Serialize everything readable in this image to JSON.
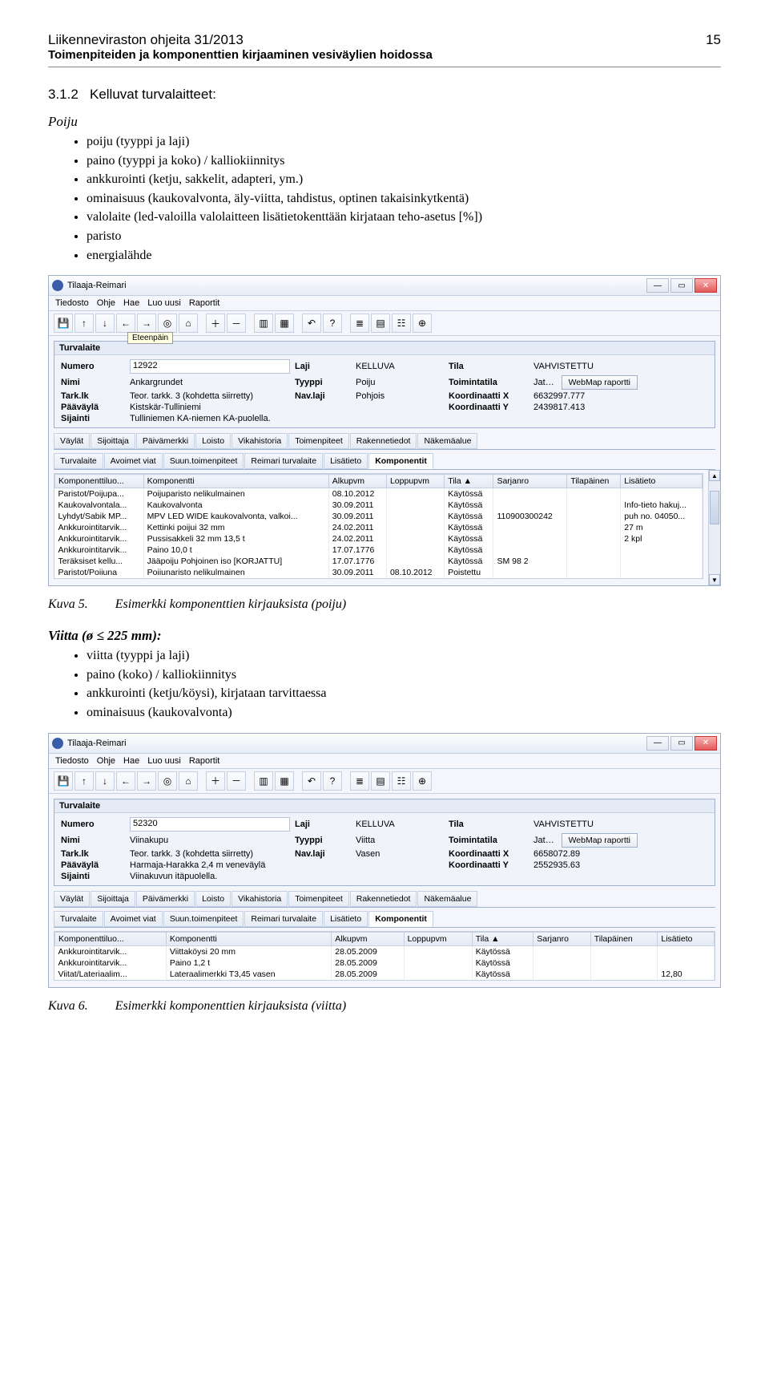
{
  "header": {
    "title": "Liikenneviraston ohjeita 31/2013",
    "page": "15",
    "subtitle": "Toimenpiteiden ja komponenttien kirjaaminen vesiväylien hoidossa"
  },
  "section": {
    "number": "3.1.2",
    "title": "Kelluvat turvalaitteet:"
  },
  "poiju_heading": "Poiju",
  "poiju_items": [
    "poiju (tyyppi ja laji)",
    "paino (tyyppi ja koko) / kalliokiinnitys",
    "ankkurointi (ketju, sakkelit, adapteri, ym.)",
    "ominaisuus (kaukovalvonta, äly-viitta, tahdistus, optinen takaisinkytkentä)",
    "valolaite (led-valoilla valolaitteen lisätietokenttään kirjataan teho-asetus [%])",
    "paristo",
    "energialähde"
  ],
  "viitta_heading": "Viitta (ø ≤ 225 mm):",
  "viitta_items": [
    "viitta (tyyppi ja laji)",
    "paino (koko) / kalliokiinnitys",
    "ankkurointi (ketju/köysi), kirjataan tarvittaessa",
    "ominaisuus (kaukovalvonta)"
  ],
  "fig5": {
    "label": "Kuva 5.",
    "caption": "Esimerkki komponenttien kirjauksista (poiju)"
  },
  "fig6": {
    "label": "Kuva 6.",
    "caption": "Esimerkki komponenttien kirjauksista (viitta)"
  },
  "app": {
    "title": "Tilaaja-Reimari",
    "menus": [
      "Tiedosto",
      "Ohje",
      "Hae",
      "Luo uusi",
      "Raportit"
    ],
    "toolbar_icons": [
      "save-icon",
      "arrow-up-icon",
      "arrow-down-icon",
      "arrow-left-icon",
      "arrow-right-icon",
      "target-icon",
      "home-icon",
      "sep",
      "plus-icon",
      "minus-icon",
      "sep",
      "columns-icon",
      "grid-icon",
      "sep",
      "undo-icon",
      "help-icon",
      "sep",
      "bars-icon",
      "table-icon",
      "chart-icon",
      "globe-icon"
    ],
    "tooltip": "Eteenpäin",
    "panel_title": "Turvalaite",
    "form_labels": {
      "Numero": "Numero",
      "Laji": "Laji",
      "Tila": "Tila",
      "Nimi": "Nimi",
      "Tyyppi": "Tyyppi",
      "Toimintatila": "Toimintatila",
      "Tarklk": "Tark.lk",
      "Navlaji": "Nav.laji",
      "KoordX": "Koordinaatti X",
      "KoordY": "Koordinaatti Y",
      "Paavayla": "Pääväylä",
      "Sijainti": "Sijainti"
    },
    "webmap_btn": "WebMap raportti",
    "tabs_top": [
      "Väylät",
      "Sijoittaja",
      "Päivämerkki",
      "Loisto",
      "Vikahistoria",
      "Toimenpiteet",
      "Rakennetiedot",
      "Näkemäalue"
    ],
    "tabs_bottom_left": [
      "Turvalaite",
      "Avoimet viat",
      "Suun.toimenpiteet",
      "Reimari turvalaite",
      "Lisätieto",
      "Komponentit"
    ],
    "grid_cols": [
      "Komponenttiluo...",
      "Komponentti",
      "Alkupvm",
      "Loppupvm",
      "Tila ▲",
      "Sarjanro",
      "Tilapäinen",
      "Lisätieto"
    ]
  },
  "app1": {
    "form": {
      "Numero": "12922",
      "Laji": "KELLUVA",
      "Tila": "VAHVISTETTU",
      "Nimi": "Ankargrundet",
      "Tyyppi": "Poiju",
      "Toimintatila": "Jatkuva",
      "Tarklk": "Teor. tarkk. 3 (kohdetta siirretty)",
      "Navlaji": "Pohjois",
      "KoordX": "6632997.777",
      "KoordY": "2439817.413",
      "Paavayla": "Kistskär-Tulliniemi",
      "Sijainti": "Tulliniemen KA-niemen KA-puolella."
    },
    "rows": [
      {
        "c": "Paristot/Poijupa...",
        "k": "Poijuparisto nelikulmainen",
        "a": "08.10.2012",
        "l": "",
        "t": "Käytössä",
        "s": "",
        "tp": "",
        "li": ""
      },
      {
        "c": "Kaukovalvontala...",
        "k": "Kaukovalvonta",
        "a": "30.09.2011",
        "l": "",
        "t": "Käytössä",
        "s": "",
        "tp": "",
        "li": "Info-tieto hakuj..."
      },
      {
        "c": "Lyhdyt/Sabik MP...",
        "k": "MPV LED WIDE kaukovalvonta, valkoi...",
        "a": "30.09.2011",
        "l": "",
        "t": "Käytössä",
        "s": "110900300242",
        "tp": "",
        "li": "puh no. 04050..."
      },
      {
        "c": "Ankkurointitarvik...",
        "k": "Kettinki poijui  32 mm",
        "a": "24.02.2011",
        "l": "",
        "t": "Käytössä",
        "s": "",
        "tp": "",
        "li": "27 m"
      },
      {
        "c": "Ankkurointitarvik...",
        "k": "Pussisakkeli 32 mm 13,5 t",
        "a": "24.02.2011",
        "l": "",
        "t": "Käytössä",
        "s": "",
        "tp": "",
        "li": "2 kpl"
      },
      {
        "c": "Ankkurointitarvik...",
        "k": "Paino 10,0 t",
        "a": "17.07.1776",
        "l": "",
        "t": "Käytössä",
        "s": "",
        "tp": "",
        "li": ""
      },
      {
        "c": "Teräksiset kellu...",
        "k": "Jääpoiju Pohjoinen iso [KORJATTU]",
        "a": "17.07.1776",
        "l": "",
        "t": "Käytössä",
        "s": "SM 98 2",
        "tp": "",
        "li": ""
      },
      {
        "c": "Paristot/Poiiuna",
        "k": "Poiiunaristo nelikulmainen",
        "a": "30.09.2011",
        "l": "08.10.2012",
        "t": "Poistettu",
        "s": "",
        "tp": "",
        "li": ""
      }
    ]
  },
  "app2": {
    "form": {
      "Numero": "52320",
      "Laji": "KELLUVA",
      "Tila": "VAHVISTETTU",
      "Nimi": "Viinakupu",
      "Tyyppi": "Viitta",
      "Toimintatila": "Jatkuva",
      "Tarklk": "Teor. tarkk. 3 (kohdetta siirretty)",
      "Navlaji": "Vasen",
      "KoordX": "6658072.89",
      "KoordY": "2552935.63",
      "Paavayla": "Harmaja-Harakka 2,4 m veneväylä",
      "Sijainti": "Viinakuvun itäpuolella."
    },
    "rows": [
      {
        "c": "Ankkurointitarvik...",
        "k": "Viittaköysi 20 mm",
        "a": "28.05.2009",
        "l": "",
        "t": "Käytössä",
        "s": "",
        "tp": "",
        "li": ""
      },
      {
        "c": "Ankkurointitarvik...",
        "k": "Paino  1,2 t",
        "a": "28.05.2009",
        "l": "",
        "t": "Käytössä",
        "s": "",
        "tp": "",
        "li": ""
      },
      {
        "c": "Viitat/Lateriaalim...",
        "k": "Lateraalimerkki T3,45  vasen",
        "a": "28.05.2009",
        "l": "",
        "t": "Käytössä",
        "s": "",
        "tp": "",
        "li": "12,80"
      }
    ]
  }
}
